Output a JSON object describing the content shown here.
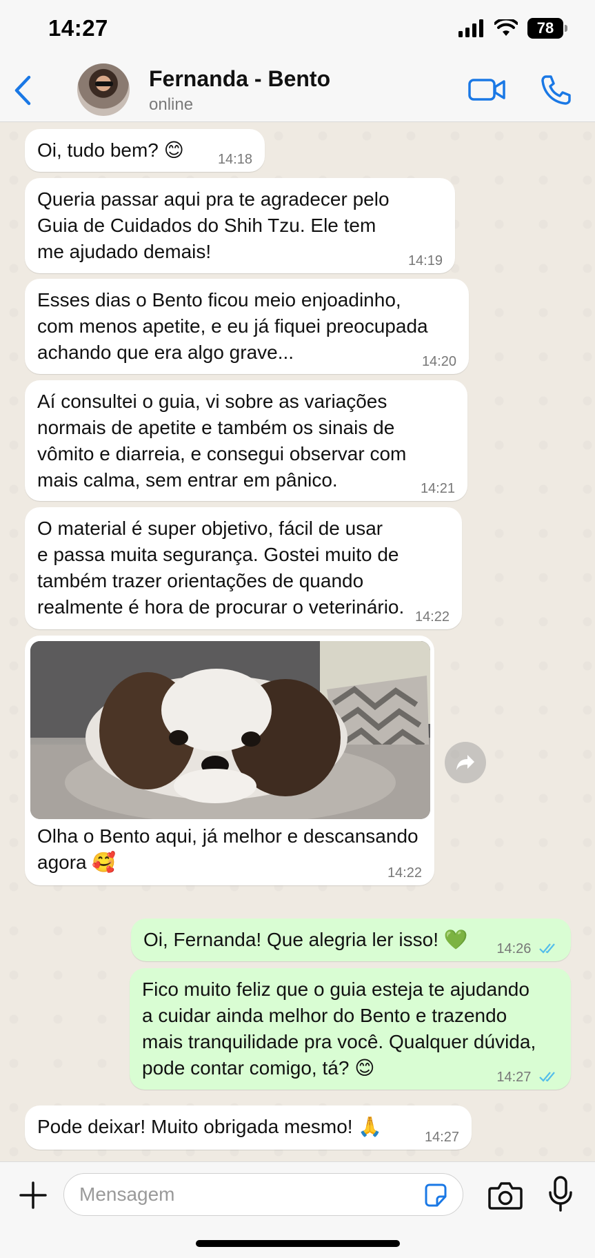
{
  "status_bar": {
    "time": "14:27",
    "battery": "78"
  },
  "header": {
    "contact_name": "Fernanda - Bento",
    "contact_status": "online"
  },
  "messages": [
    {
      "text": "Oi, tudo bem? 😊",
      "time": "14:18"
    },
    {
      "text": "Queria passar aqui pra te agradecer pelo\nGuia de Cuidados do Shih Tzu. Ele tem\nme ajudado demais!",
      "time": "14:19"
    },
    {
      "text": "Esses dias o Bento ficou meio enjoadinho,\ncom menos apetite, e eu já fiquei preocupada\nachando que era algo grave...",
      "time": "14:20"
    },
    {
      "text": "Aí consultei o guia, vi sobre as variações\nnormais de apetite e também os sinais de\nvômito e diarreia, e consegui observar com\nmais calma, sem entrar em pânico.",
      "time": "14:21"
    },
    {
      "text": "O material é super objetivo, fácil de usar\ne passa muita segurança. Gostei muito de\ntambém trazer orientações de quando\nrealmente é hora de procurar o veterinário.",
      "time": "14:22"
    },
    {
      "text": "Olha o Bento aqui, já melhor e descansando\nagora 🥰",
      "time": "14:22"
    },
    {
      "text": "Oi, Fernanda! Que alegria ler isso! 💚",
      "time": "14:26"
    },
    {
      "text": "Fico muito feliz que o guia esteja te ajudando\na cuidar ainda melhor do Bento e trazendo\nmais tranquilidade pra você. Qualquer dúvida,\npode contar comigo, tá? 😊",
      "time": "14:27"
    },
    {
      "text": "Pode deixar! Muito obrigada mesmo! 🙏",
      "time": "14:27"
    }
  ],
  "input": {
    "placeholder": "Mensagem"
  },
  "colors": {
    "accent": "#1a78e5",
    "incoming": "#ffffff",
    "outgoing": "#d9fdd3",
    "chat_bg": "#efeae2",
    "read_ticks": "#53bdeb"
  },
  "icons": [
    "back-chevron-icon",
    "video-call-icon",
    "phone-icon",
    "forward-icon",
    "plus-icon",
    "sticker-icon",
    "camera-icon",
    "microphone-icon",
    "read-ticks-icon"
  ]
}
